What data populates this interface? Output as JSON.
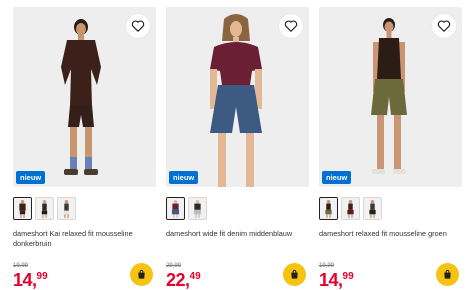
{
  "badge_label": "nieuw",
  "colors": {
    "badge": "#0070d2",
    "price": "#e4002b",
    "cart": "#f7c313"
  },
  "icons": {
    "favorite": "heart-outline-icon",
    "cart": "shopping-bag-icon"
  },
  "products": [
    {
      "title": "dameshort Kai relaxed fit mousseline donkerbruin",
      "old_price": "19,99",
      "price_int": "14,",
      "price_dec": "99",
      "thumbs": [
        "donkerbruin",
        "zwart",
        "wit"
      ],
      "selected_thumb": 0
    },
    {
      "title": "dameshort wide fit denim middenblauw",
      "old_price": "29,99",
      "price_int": "22,",
      "price_dec": "49",
      "thumbs": [
        "middenblauw",
        "lichtgrijs"
      ],
      "selected_thumb": 0
    },
    {
      "title": "dameshort relaxed fit mousseline groen",
      "old_price": "19,99",
      "price_int": "14,",
      "price_dec": "99",
      "thumbs": [
        "groen",
        "donkerbruin",
        "zwart"
      ],
      "selected_thumb": 0
    }
  ]
}
